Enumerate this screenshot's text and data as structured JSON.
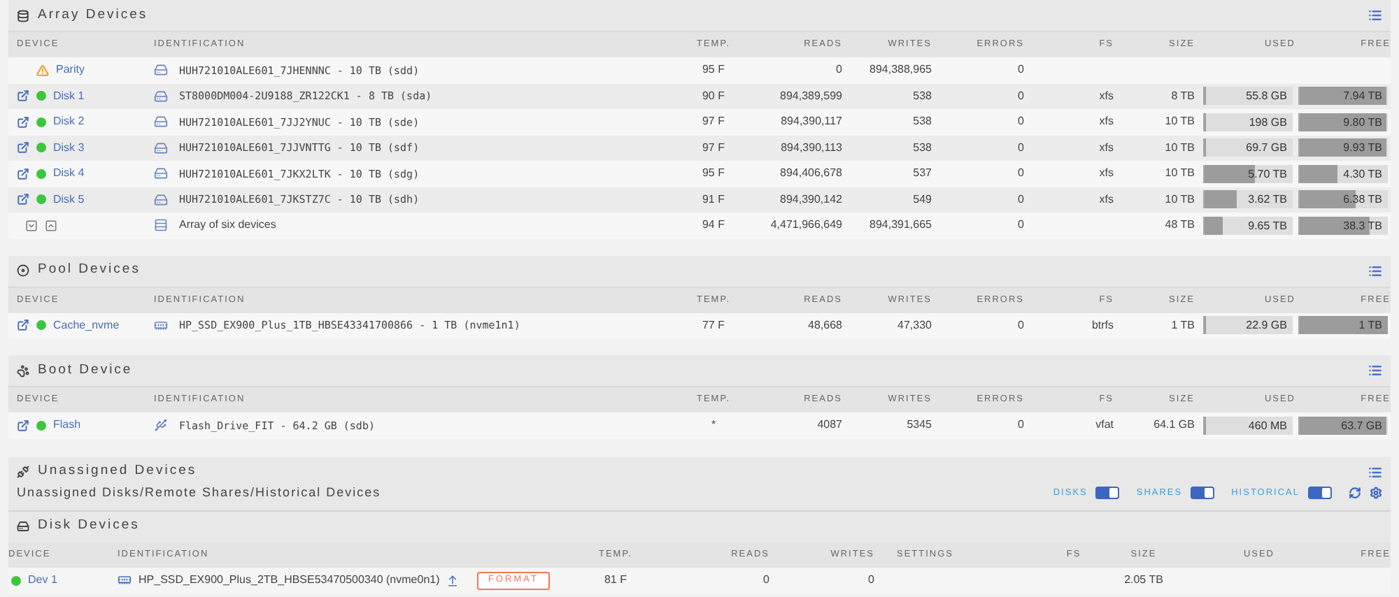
{
  "sections": [
    {
      "title": "Array Devices",
      "columns": [
        "DEVICE",
        "IDENTIFICATION",
        "TEMP.",
        "READS",
        "WRITES",
        "ERRORS",
        "FS",
        "SIZE",
        "USED",
        "FREE"
      ],
      "rows": [
        {
          "kind": "device",
          "device": "Parity",
          "link": false,
          "warning": true,
          "identification": "HUH721010ALE601_7JHENNNC - 10 TB (sdd)",
          "temp": "95 F",
          "reads": "0",
          "writes": "894,388,965",
          "errors": "0"
        },
        {
          "kind": "device",
          "device": "Disk 1",
          "link": true,
          "warning": false,
          "identification": "ST8000DM004-2U9188_ZR122CK1 - 8 TB (sda)",
          "temp": "90 F",
          "reads": "894,389,599",
          "writes": "538",
          "errors": "0",
          "fs": "xfs",
          "size": "8 TB",
          "used": {
            "text": "55.8 GB",
            "level": 0.01
          },
          "free": {
            "text": "7.94 TB",
            "level": 0.99
          }
        },
        {
          "kind": "device",
          "device": "Disk 2",
          "link": true,
          "warning": false,
          "identification": "HUH721010ALE601_7JJ2YNUC - 10 TB (sde)",
          "temp": "97 F",
          "reads": "894,390,117",
          "writes": "538",
          "errors": "0",
          "fs": "xfs",
          "size": "10 TB",
          "used": {
            "text": "198 GB",
            "level": 0.02
          },
          "free": {
            "text": "9.80 TB",
            "level": 0.98
          }
        },
        {
          "kind": "device",
          "device": "Disk 3",
          "link": true,
          "warning": false,
          "identification": "HUH721010ALE601_7JJVNTTG - 10 TB (sdf)",
          "temp": "97 F",
          "reads": "894,390,113",
          "writes": "538",
          "errors": "0",
          "fs": "xfs",
          "size": "10 TB",
          "used": {
            "text": "69.7 GB",
            "level": 0.01
          },
          "free": {
            "text": "9.93 TB",
            "level": 0.99
          }
        },
        {
          "kind": "device",
          "device": "Disk 4",
          "link": true,
          "warning": false,
          "identification": "HUH721010ALE601_7JKX2LTK - 10 TB (sdg)",
          "temp": "95 F",
          "reads": "894,406,678",
          "writes": "537",
          "errors": "0",
          "fs": "xfs",
          "size": "10 TB",
          "used": {
            "text": "5.70 TB",
            "level": 0.57
          },
          "free": {
            "text": "4.30 TB",
            "level": 0.43
          }
        },
        {
          "kind": "device",
          "device": "Disk 5",
          "link": true,
          "warning": false,
          "identification": "HUH721010ALE601_7JKSTZ7C - 10 TB (sdh)",
          "temp": "91 F",
          "reads": "894,390,142",
          "writes": "549",
          "errors": "0",
          "fs": "xfs",
          "size": "10 TB",
          "used": {
            "text": "3.62 TB",
            "level": 0.36
          },
          "free": {
            "text": "6.38 TB",
            "level": 0.64
          }
        },
        {
          "kind": "summary",
          "identification": "Array of six devices",
          "temp": "94 F",
          "reads": "4,471,966,649",
          "writes": "894,391,665",
          "errors": "0",
          "size": "48 TB",
          "used": {
            "text": "9.65 TB",
            "level": 0.2
          },
          "free": {
            "text": "38.3 TB",
            "level": 0.8
          }
        }
      ]
    },
    {
      "title": "Pool Devices",
      "columns": [
        "DEVICE",
        "IDENTIFICATION",
        "TEMP.",
        "READS",
        "WRITES",
        "ERRORS",
        "FS",
        "SIZE",
        "USED",
        "FREE"
      ],
      "rows": [
        {
          "kind": "device",
          "device": "Cache_nvme",
          "link": true,
          "warning": false,
          "identification": "HP_SSD_EX900_Plus_1TB_HBSE43341700866 - 1 TB (nvme1n1)",
          "temp": "77 F",
          "reads": "48,668",
          "writes": "47,330",
          "errors": "0",
          "fs": "btrfs",
          "size": "1 TB",
          "used": {
            "text": "22.9 GB",
            "level": 0.02
          },
          "free": {
            "text": "1 TB",
            "level": 1
          }
        }
      ]
    },
    {
      "title": "Boot Device",
      "columns": [
        "DEVICE",
        "IDENTIFICATION",
        "TEMP.",
        "READS",
        "WRITES",
        "ERRORS",
        "FS",
        "SIZE",
        "USED",
        "FREE"
      ],
      "rows": [
        {
          "kind": "device",
          "device": "Flash",
          "link": true,
          "warning": false,
          "identification": "Flash_Drive_FIT - 64.2 GB (sdb)",
          "temp": "*",
          "reads": "4087",
          "writes": "5345",
          "errors": "0",
          "fs": "vfat",
          "size": "64.1 GB",
          "used": {
            "text": "460 MB",
            "level": 0.01
          },
          "free": {
            "text": "63.7 GB",
            "level": 0.99
          }
        }
      ]
    }
  ],
  "unassigned": {
    "title": "Unassigned Devices",
    "subtitle": "Unassigned Disks/Remote Shares/Historical Devices",
    "toggles": [
      {
        "label": "DISKS",
        "on": true
      },
      {
        "label": "SHARES",
        "on": true
      },
      {
        "label": "HISTORICAL",
        "on": true
      }
    ],
    "disk_devices": {
      "title": "Disk Devices",
      "columns": [
        "DEVICE",
        "IDENTIFICATION",
        "TEMP.",
        "READS",
        "WRITES",
        "SETTINGS",
        "FS",
        "SIZE",
        "USED",
        "FREE"
      ],
      "rows": [
        {
          "device": "Dev 1",
          "identification": "HP_SSD_EX900_Plus_2TB_HBSE53470500340 (nvme0n1)",
          "action": "FORMAT",
          "temp": "81 F",
          "reads": "0",
          "writes": "0",
          "size": "2.05 TB"
        }
      ]
    }
  }
}
